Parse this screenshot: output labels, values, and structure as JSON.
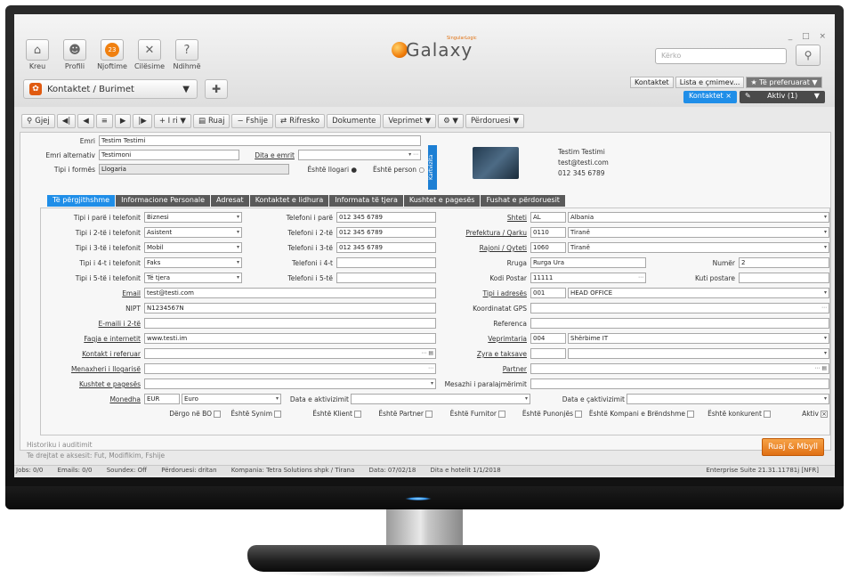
{
  "header": {
    "nav": [
      "Kreu",
      "Profili",
      "Njoftime",
      "Cilësime",
      "Ndihmë"
    ],
    "badge": "23",
    "breadcrumb": "Kontaktet / Burimet",
    "logo_text": "Galaxy",
    "logo_sub": "SingularLogic",
    "search_placeholder": "Kërko",
    "related_tabs": [
      "Kontaktet",
      "Lista e çmimev...",
      "★ Të preferuarat ▼"
    ],
    "open_tab": "Kontaktet ×",
    "active_label": "Aktiv (1)"
  },
  "toolbar": [
    "Gjej",
    "◀|",
    "◀",
    "≡",
    "▶",
    "|▶",
    "+ I ri ▼",
    "Ruaj",
    "− Fshije",
    "Rifresko",
    "Dokumente",
    "Veprimet ▼",
    "⚙ ▼",
    "Përdoruesi ▼"
  ],
  "top_fields": {
    "emri_lbl": "Emri",
    "emri": "Testim Testimi",
    "alt_lbl": "Emri alternativ",
    "alt": "Testimoni",
    "dita_lbl": "Dita e emrit",
    "forma_lbl": "Tipi i formës",
    "forma": "Llogaria",
    "llogari": "Është llogari",
    "person": "Është person",
    "kartvizita": "Kartvizita",
    "card_name": "Testim Testimi",
    "card_email": "test@testi.com",
    "card_phone": "012 345 6789"
  },
  "tabs": [
    "Të përgjithshme",
    "Informacione Personale",
    "Adresat",
    "Kontaktet e lidhura",
    "Informata të tjera",
    "Kushtet e pagesës",
    "Fushat e përdoruesit"
  ],
  "left": [
    {
      "l": "Tipi i parë i telefonit",
      "v": "Biznesi"
    },
    {
      "l": "Tipi i 2-të i telefonit",
      "v": "Asistent"
    },
    {
      "l": "Tipi i 3-të i telefonit",
      "v": "Mobil"
    },
    {
      "l": "Tipi i 4-t i telefonit",
      "v": "Faks"
    },
    {
      "l": "Tipi i 5-të i telefonit",
      "v": "Të tjera"
    }
  ],
  "phones": [
    {
      "l": "Telefoni i parë",
      "v": "012 345 6789"
    },
    {
      "l": "Telefoni i 2-të",
      "v": "012 345 6789"
    },
    {
      "l": "Telefoni i 3-të",
      "v": "012 345 6789"
    },
    {
      "l": "Telefoni i 4-t",
      "v": ""
    },
    {
      "l": "Telefoni i 5-të",
      "v": ""
    }
  ],
  "misc": [
    {
      "l": "Email",
      "v": "test@testi.com"
    },
    {
      "l": "NIPT",
      "v": "N1234567N"
    },
    {
      "l": "E-maili i 2-të",
      "v": ""
    },
    {
      "l": "Faqja e internetit",
      "v": "www.testi.im"
    },
    {
      "l": "Kontakt i referuar",
      "v": ""
    },
    {
      "l": "Menaxheri i llogarisë",
      "v": ""
    },
    {
      "l": "Kushtet e pagesës",
      "v": ""
    }
  ],
  "right": {
    "shteti": "Shteti",
    "shteti_c": "AL",
    "shteti_v": "Albania",
    "pref": "Prefektura / Qarku",
    "pref_c": "0110",
    "pref_v": "Tiranë",
    "rajon": "Rajoni / Qyteti",
    "rajon_c": "1060",
    "rajon_v": "Tiranë",
    "rruga": "Rruga",
    "rruga_v": "Rurga Ura",
    "numer": "Numër",
    "numer_v": "2",
    "kodi": "Kodi Postar",
    "kodi_v": "11111",
    "kuti": "Kuti postare",
    "tipi_adr": "Tipi i adresës",
    "tipi_adr_c": "001",
    "tipi_adr_v": "HEAD OFFICE",
    "gps": "Koordinatat GPS",
    "ref": "Referenca",
    "vepr": "Veprimtaria",
    "vepr_c": "004",
    "vepr_v": "Shërbime IT",
    "zyra": "Zyra e taksave",
    "partner": "Partner",
    "mesazh": "Mesazhi i paralajmërimit"
  },
  "currency": {
    "l": "Monedha",
    "c": "EUR",
    "v": "Euro",
    "akt": "Data e aktivizimit",
    "cakt": "Data e çaktivizimit"
  },
  "checks": [
    "Dërgo në BO",
    "Është Synim",
    "Është Klient",
    "Është Partner",
    "Është Furnitor",
    "Është Punonjës",
    "Është Kompani e Brëndshme",
    "Është konkurent",
    "Aktiv"
  ],
  "history": [
    "Historiku i auditimit",
    "Te drejtat e aksesit: Fut, Modifikim, Fshije"
  ],
  "save": "Ruaj & Mbyll",
  "status": [
    "Jobs: 0/0",
    "Emails: 0/0",
    "Soundex: Off",
    "Përdoruesi: dritan",
    "Kompania: Tetra Solutions shpk / Tirana",
    "Data: 07/02/18",
    "Dita e hotelit 1/1/2018"
  ],
  "status_right": "Enterprise Suite 21.31.11781j [NFR]"
}
